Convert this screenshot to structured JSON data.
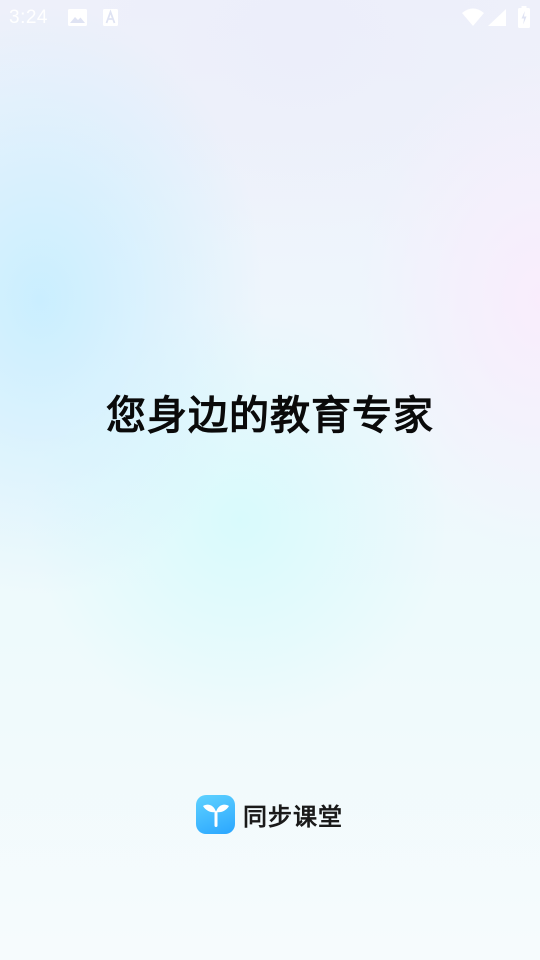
{
  "status_bar": {
    "time": "3:24",
    "notification_icons": [
      "image-icon",
      "a-icon"
    ],
    "system_icons": [
      "wifi-icon",
      "signal-icon",
      "battery-icon"
    ]
  },
  "splash": {
    "slogan": "您身边的教育专家"
  },
  "brand": {
    "logo_icon": "sprout-icon",
    "name": "同步课堂",
    "logo_color": "#2aa6ff"
  }
}
